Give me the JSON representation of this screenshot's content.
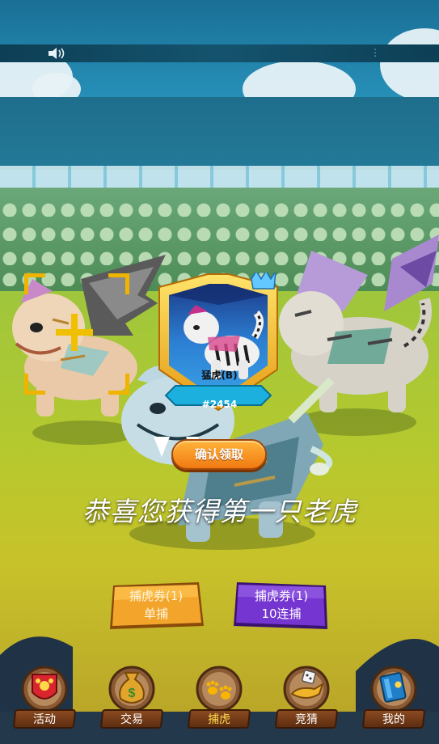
{
  "header": {
    "sound_icon": "speaker-icon",
    "menu_dots": "⋮"
  },
  "reward_card": {
    "name": "猛虎(B)",
    "id": "#2454"
  },
  "confirm_button": {
    "label": "确认领取"
  },
  "congrats_text": "恭喜您获得第一只老虎",
  "capture_buttons": [
    {
      "line1": "捕虎券(1)",
      "line2": "单捕",
      "color": "#f0a020"
    },
    {
      "line1": "捕虎券(1)",
      "line2": "10连捕",
      "color": "#6a2bc0"
    }
  ],
  "bottom_nav": {
    "active": "捕虎",
    "items": [
      {
        "label": "活动",
        "icon": "activity-shield-icon"
      },
      {
        "label": "交易",
        "icon": "money-bag-icon"
      },
      {
        "label": "捕虎",
        "icon": "paw-prints-icon"
      },
      {
        "label": "竞猜",
        "icon": "dice-lamp-icon"
      },
      {
        "label": "我的",
        "icon": "book-icon"
      }
    ]
  },
  "colors": {
    "accent_orange": "#f07a12",
    "accent_purple": "#6a2bc0",
    "card_blue": "#2a7fd4",
    "card_gold": "#f5c12a"
  }
}
